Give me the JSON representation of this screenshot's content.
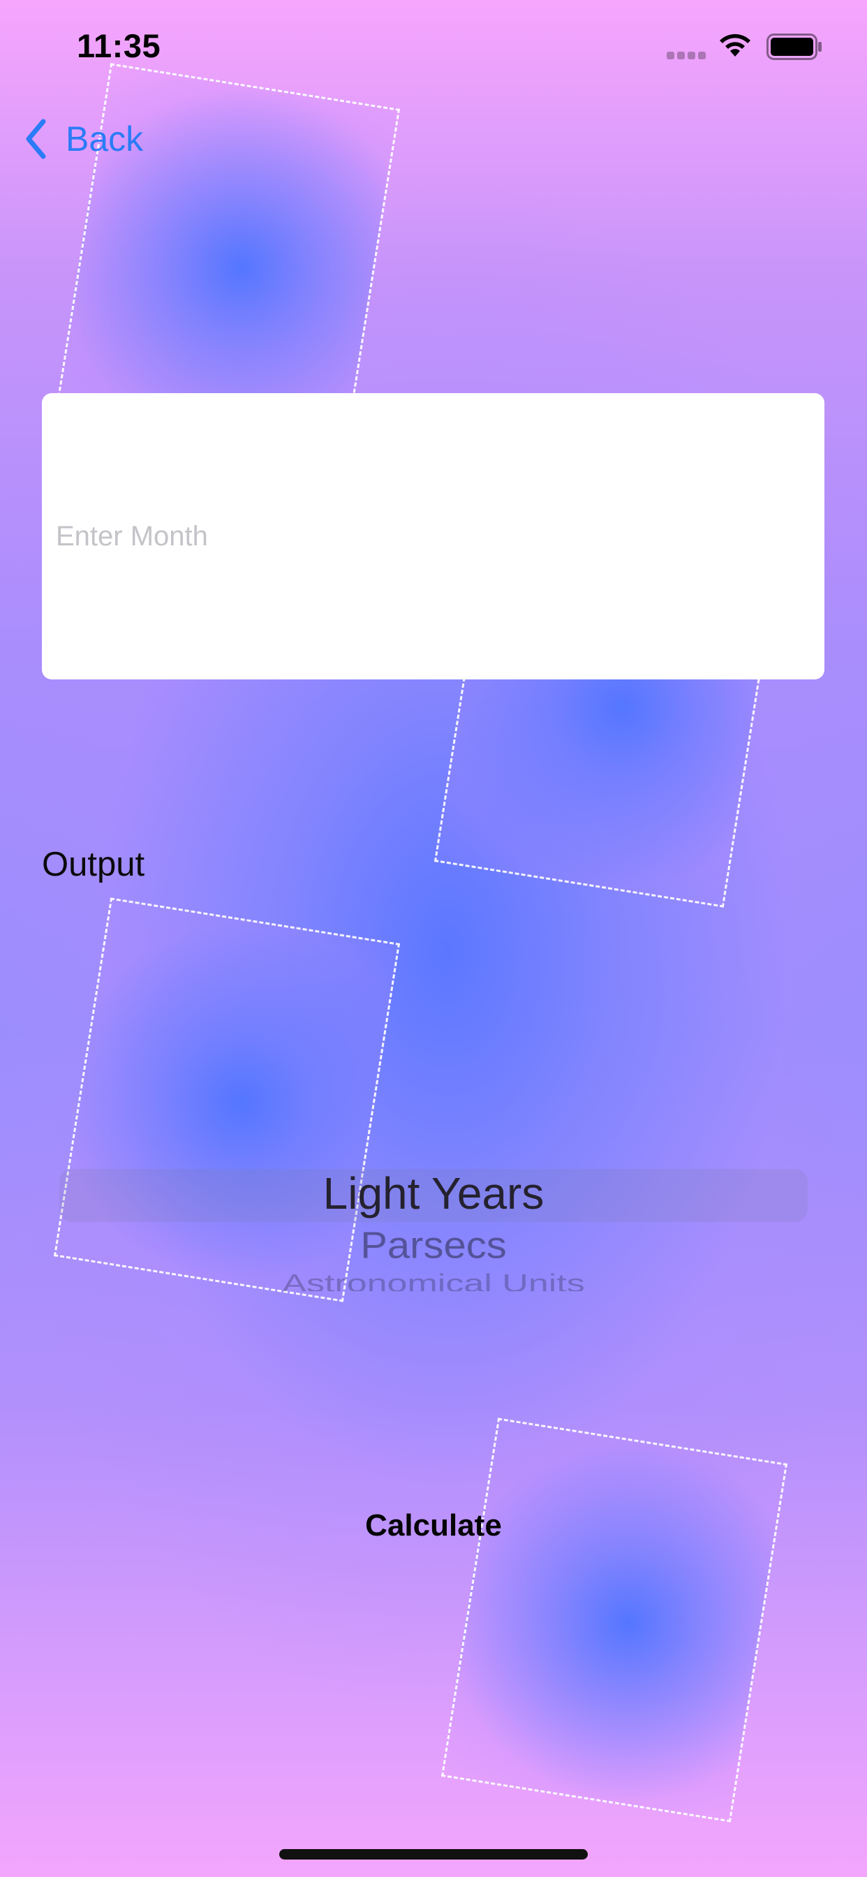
{
  "status_bar": {
    "time": "11:35"
  },
  "nav": {
    "back_label": "Back",
    "back_icon": "chevron-left-icon"
  },
  "input": {
    "value": "",
    "placeholder": "Enter Month"
  },
  "output": {
    "label": "Output"
  },
  "picker": {
    "options": [
      "Light Years",
      "Parsecs",
      "Astronomical Units"
    ],
    "selected": "Light Years"
  },
  "actions": {
    "calculate_label": "Calculate"
  },
  "colors": {
    "accent": "#2b7bf7",
    "background_top": "#f7a6fd",
    "background_center": "#5876ff"
  }
}
